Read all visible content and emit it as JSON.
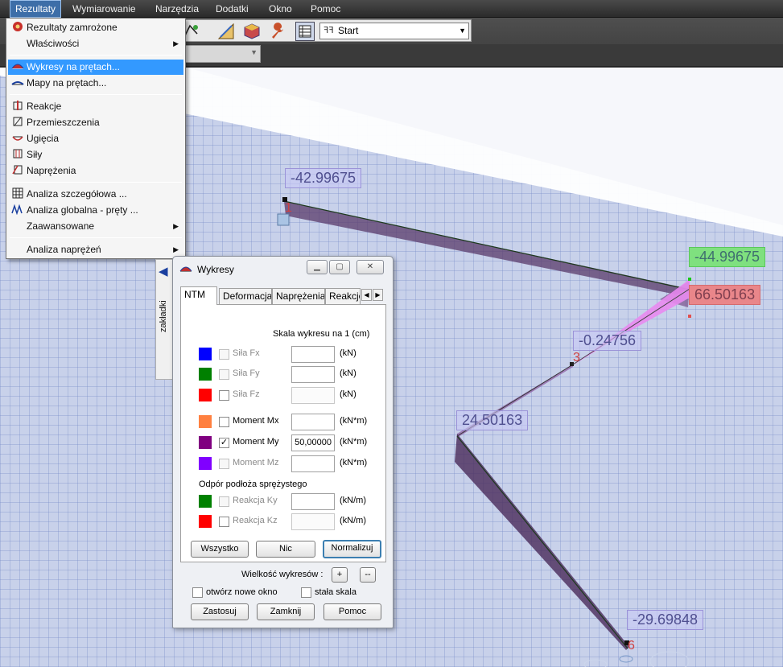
{
  "menubar": {
    "items": [
      {
        "label": "Rezultaty",
        "active": true
      },
      {
        "label": "Wymiarowanie"
      },
      {
        "label": "Narzędzia"
      },
      {
        "label": "Dodatki"
      },
      {
        "label": "Okno"
      },
      {
        "label": "Pomoc"
      }
    ]
  },
  "toolbar": {
    "case_combo": "Start"
  },
  "menu": {
    "items": [
      {
        "label": "Rezultaty zamrożone"
      },
      {
        "label": "Właściwości",
        "submenu": true
      },
      {
        "label": "Wykresy na prętach...",
        "highlighted": true
      },
      {
        "label": "Mapy na prętach..."
      },
      {
        "label": "Reakcje"
      },
      {
        "label": "Przemieszczenia"
      },
      {
        "label": "Ugięcia"
      },
      {
        "label": "Siły"
      },
      {
        "label": "Naprężenia"
      },
      {
        "label": "Analiza szczegółowa ..."
      },
      {
        "label": "Analiza globalna - pręty ..."
      },
      {
        "label": "Zaawansowane",
        "submenu": true
      },
      {
        "label": "Analiza naprężeń",
        "submenu": true
      }
    ]
  },
  "sidetab": {
    "label": "zakładki"
  },
  "dialog": {
    "title": "Wykresy",
    "tabs": [
      "NTM",
      "Deformacja",
      "Naprężenia",
      "Reakcje"
    ],
    "scale_label": "Skala wykresu na 1  (cm)",
    "rows": [
      {
        "label": "Siła Fx",
        "unit": "(kN)",
        "value": "",
        "checked": false,
        "enabled": false,
        "color": "#0000ff"
      },
      {
        "label": "Siła Fy",
        "unit": "(kN)",
        "value": "",
        "checked": false,
        "enabled": false,
        "color": "#008000"
      },
      {
        "label": "Siła Fz",
        "unit": "(kN)",
        "value": "",
        "checked": false,
        "enabled": false,
        "color": "#ff0000"
      },
      {
        "label": "Moment Mx",
        "unit": "(kN*m)",
        "value": "",
        "checked": false,
        "enabled": true,
        "color": "#ff8040"
      },
      {
        "label": "Moment My",
        "unit": "(kN*m)",
        "value": "50,00000",
        "checked": true,
        "enabled": true,
        "color": "#800080"
      },
      {
        "label": "Moment Mz",
        "unit": "(kN*m)",
        "value": "",
        "checked": false,
        "enabled": false,
        "color": "#8000ff"
      }
    ],
    "subgrade_group": "Odpór podłoża sprężystego",
    "subgrade_rows": [
      {
        "label": "Reakcja Ky",
        "unit": "(kN/m)",
        "value": "",
        "checked": false,
        "enabled": false,
        "color": "#008000"
      },
      {
        "label": "Reakcja Kz",
        "unit": "(kN/m)",
        "value": "",
        "checked": false,
        "enabled": true,
        "color": "#ff0000"
      }
    ],
    "btn_all": "Wszystko",
    "btn_none": "Nic",
    "btn_normalize": "Normalizuj",
    "size_label": "Wielkość wykresów :",
    "size_plus": "+",
    "size_minus": "--",
    "open_new_window": "otwórz nowe okno",
    "fixed_scale": "stała  skala",
    "btn_apply": "Zastosuj",
    "btn_close": "Zamknij",
    "btn_help": "Pomoc"
  },
  "viewport": {
    "labels": [
      {
        "value": "-42.99675",
        "style": "plain"
      },
      {
        "value": "-44.99675",
        "style": "green"
      },
      {
        "value": "66.50163",
        "style": "red"
      },
      {
        "value": "-0.24756",
        "style": "plain"
      },
      {
        "value": "24.50163",
        "style": "plain"
      },
      {
        "value": "-29.69848",
        "style": "plain"
      }
    ],
    "node_numbers": [
      "1",
      "3",
      "6"
    ]
  }
}
